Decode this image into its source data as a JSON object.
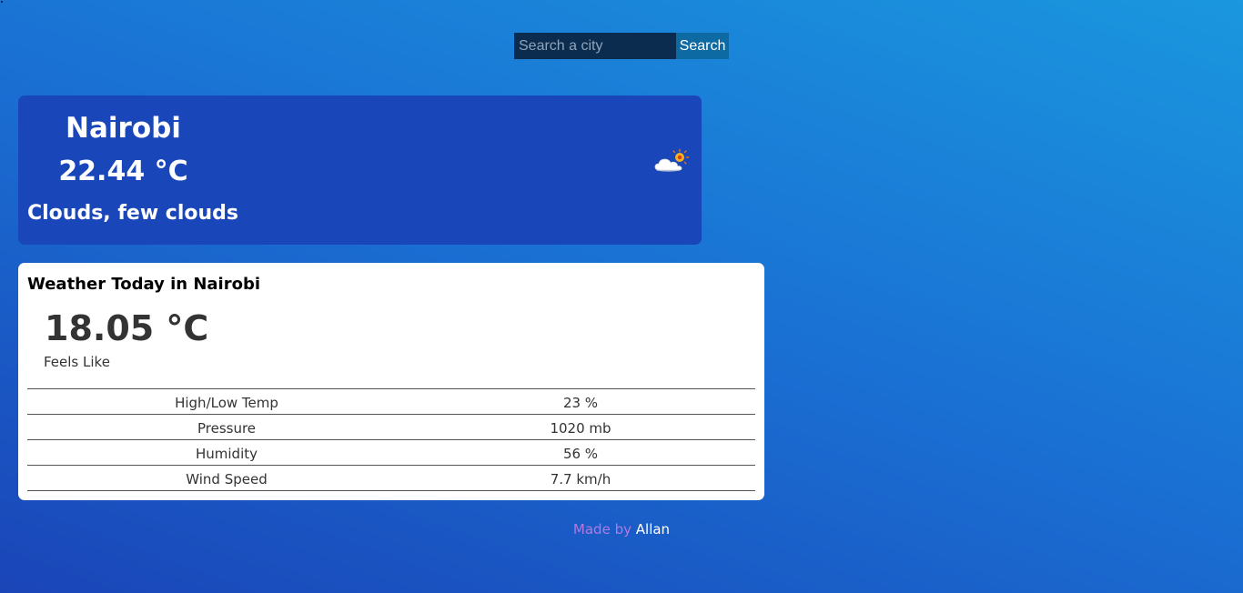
{
  "search": {
    "placeholder": "Search a city",
    "button_label": "Search"
  },
  "current": {
    "city": "Nairobi",
    "temperature": "22.44 °C",
    "description": "Clouds, few clouds",
    "icon": "few-clouds-icon"
  },
  "details": {
    "title": "Weather Today in Nairobi",
    "feels_like_temp": "18.05 °C",
    "feels_like_label": "Feels Like",
    "rows": [
      {
        "label": "High/Low Temp",
        "value": "23 %"
      },
      {
        "label": "Pressure",
        "value": "1020 mb"
      },
      {
        "label": "Humidity",
        "value": "56 %"
      },
      {
        "label": "Wind Speed",
        "value": "7.7 km/h"
      }
    ]
  },
  "footer": {
    "made_by": "Made by",
    "author": "Allan"
  },
  "colors": {
    "current_card": "#1947ba",
    "search_input": "#0b2c4e",
    "search_button": "#0e6aa3",
    "footer_made": "#b07ae0"
  }
}
